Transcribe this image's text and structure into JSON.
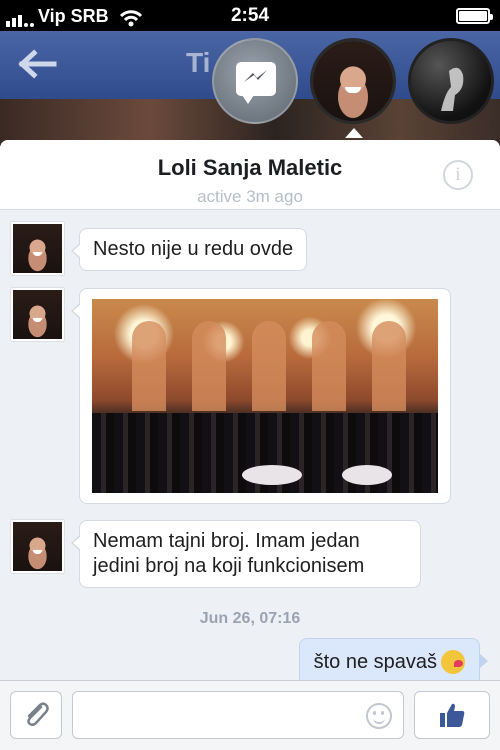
{
  "status_bar": {
    "carrier": "Vip SRB",
    "time": "2:54"
  },
  "nav": {
    "title_partial": "Ti"
  },
  "chat_heads": [
    {
      "name": "messenger",
      "icon": "messenger-icon"
    },
    {
      "name": "Loli Sanja Maletic",
      "active": true
    },
    {
      "name": "other-contact"
    }
  ],
  "conversation": {
    "contact_name": "Loli Sanja Maletic",
    "status": "active 3m ago",
    "info_icon": "info-icon",
    "messages": [
      {
        "direction": "incoming",
        "text": "Nesto nije u redu ovde"
      },
      {
        "direction": "incoming",
        "type": "photo"
      },
      {
        "direction": "incoming",
        "text": "Nemam tajni broj. Imam jedan jedini broj na koji funkcionisem"
      }
    ],
    "timestamp": "Jun 26, 07:16",
    "outgoing": {
      "direction": "outgoing",
      "text": "što ne spavaš",
      "emoji": "kissing-face-emoji"
    }
  },
  "composer": {
    "placeholder": "",
    "attach_icon": "paperclip-icon",
    "emoji_icon": "smiley-icon",
    "send_icon": "thumbs-up-icon"
  },
  "colors": {
    "nav_blue": "#3b5998",
    "incoming_bubble": "#ffffff",
    "outgoing_bubble": "#dbe8fb",
    "panel_bg": "#edf1f6"
  }
}
